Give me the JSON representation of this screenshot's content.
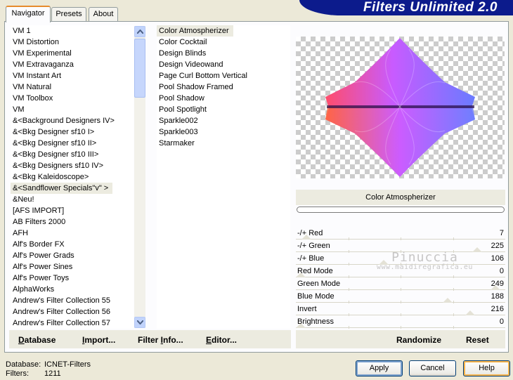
{
  "app": {
    "title": "Filters Unlimited 2.0"
  },
  "tabs": [
    {
      "label": "Navigator",
      "active": true
    },
    {
      "label": "Presets",
      "active": false
    },
    {
      "label": "About",
      "active": false
    }
  ],
  "categories": {
    "items": [
      "VM 1",
      "VM Distortion",
      "VM Experimental",
      "VM Extravaganza",
      "VM Instant Art",
      "VM Natural",
      "VM Toolbox",
      "VM",
      "&<Background Designers IV>",
      "&<Bkg Designer sf10 I>",
      "&<Bkg Designer sf10 II>",
      "&<Bkg Designer sf10 III>",
      "&<Bkg Designers sf10 IV>",
      "&<Bkg Kaleidoscope>",
      "&<Sandflower Specials\"v\" >",
      "&Neu!",
      "[AFS IMPORT]",
      "AB Filters 2000",
      "AFH",
      "Alf's Border FX",
      "Alf's Power Grads",
      "Alf's Power Sines",
      "Alf's Power Toys",
      "AlphaWorks",
      "Andrew's Filter Collection 55",
      "Andrew's Filter Collection 56",
      "Andrew's Filter Collection 57"
    ],
    "selected_index": 14
  },
  "filters": {
    "items": [
      "Color Atmospherizer",
      "Color Cocktail",
      "Design Blinds",
      "Design Videowand",
      "Page Curl Bottom Vertical",
      "Pool Shadow Framed",
      "Pool Shadow",
      "Pool Spotlight",
      "Sparkle002",
      "Sparkle003",
      "Starmaker"
    ],
    "selected_index": 0
  },
  "preview": {
    "filter_name": "Color Atmospherizer"
  },
  "parameters": [
    {
      "label": "-/+ Red",
      "value": 7
    },
    {
      "label": "-/+ Green",
      "value": 225
    },
    {
      "label": "-/+ Blue",
      "value": 106
    },
    {
      "label": "Red Mode",
      "value": 0
    },
    {
      "label": "Green Mode",
      "value": 249
    },
    {
      "label": "Blue Mode",
      "value": 188
    },
    {
      "label": "Invert",
      "value": 216
    },
    {
      "label": "Brightness",
      "value": 0
    }
  ],
  "watermark": {
    "line1": "Pinuccia",
    "line2": "www.maidiregrafica.eu"
  },
  "toolbar_left": {
    "database": {
      "first": "D",
      "rest": "atabase"
    },
    "import": {
      "first": "I",
      "rest": "mport..."
    },
    "filter_info": {
      "first": "Filter ",
      "u": "I",
      "rest": "nfo..."
    },
    "editor": {
      "first": "E",
      "rest": "ditor..."
    }
  },
  "toolbar_right": {
    "randomize": "Randomize",
    "reset": "Reset"
  },
  "status": {
    "database_label": "Database:",
    "database_value": "ICNET-Filters",
    "filters_label": "Filters:",
    "filters_value": "1211"
  },
  "buttons": {
    "apply": "Apply",
    "cancel": "Cancel",
    "help": "Help"
  },
  "colors": {
    "banner": "#0c1b8c",
    "tab_highlight": "#e68b2c"
  }
}
